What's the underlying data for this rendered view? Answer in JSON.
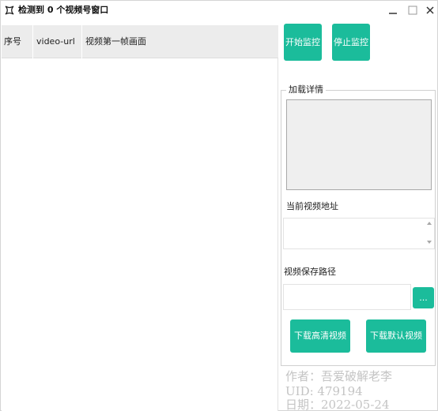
{
  "window": {
    "title": "检测到 0 个视频号窗口",
    "icon": "app-logo-icon"
  },
  "table": {
    "columns": [
      "序号",
      "video-url",
      "视频第一帧画面"
    ],
    "rows": []
  },
  "controls": {
    "start_label": "开始监控",
    "stop_label": "停止监控"
  },
  "details": {
    "legend": "加载详情",
    "current_url_label": "当前视频地址",
    "current_url_value": "",
    "save_path_label": "视频保存路径",
    "save_path_value": "",
    "browse_label": "...",
    "download_hd_label": "下载高清视频",
    "download_default_label": "下载默认视频"
  },
  "watermark": {
    "author": "作者：吾爱破解老李",
    "uid": "UID: 479194",
    "date": "日期：2022-05-24"
  },
  "colors": {
    "accent": "#1bbc9b",
    "header_bg": "#ececec",
    "watermark": "#c4c4c4"
  }
}
